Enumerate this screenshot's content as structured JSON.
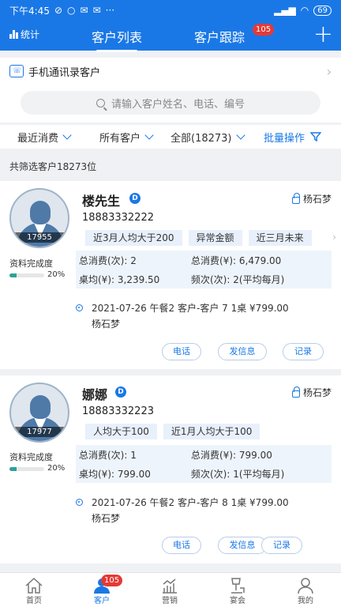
{
  "status_bar": {
    "time": "下午4:45",
    "dots": "···",
    "battery": "69"
  },
  "nav": {
    "stats_label": "统计",
    "tab_customer_list": "客户列表",
    "tab_customer_follow": "客户跟踪",
    "follow_badge": "105",
    "add": "+"
  },
  "contacts_label": "手机通讯录客户",
  "search": {
    "placeholder": "请输入客户姓名、电话、编号"
  },
  "filters": {
    "recent": "最近消费",
    "all_customers": "所有客户",
    "all_count": "全部(18273)",
    "batch": "批量操作"
  },
  "summary": "共筛选客户18273位",
  "labels": {
    "completeness": "资料完成度",
    "total_count": "总消费(次):",
    "total_amount": "总消费(¥):",
    "per_table": "桌均(¥):",
    "frequency": "频次(次):",
    "call": "电话",
    "message": "发信息",
    "record": "记录"
  },
  "customers": [
    {
      "id": "17955",
      "name": "楼先生",
      "level": "D",
      "owner": "杨石梦",
      "phone": "18883332222",
      "tags": [
        "近3月人均大于200",
        "异常金额",
        "近三月未来"
      ],
      "completeness": "20%",
      "completeness_value": 0.2,
      "total_count": "2",
      "total_amount": "6,479.00",
      "per_table": "3,239.50",
      "frequency": "2(平均每月)",
      "record_line": "2021-07-26   午餐2   客户-客户   7   1桌   ¥799.00",
      "record_staff": "杨石梦"
    },
    {
      "id": "17977",
      "name": "娜娜",
      "level": "D",
      "owner": "杨石梦",
      "phone": "18883332223",
      "tags": [
        "人均大于100",
        "近1月人均大于100"
      ],
      "completeness": "20%",
      "completeness_value": 0.2,
      "total_count": "1",
      "total_amount": "799.00",
      "per_table": "799.00",
      "frequency": "1(平均每月)",
      "record_line": "2021-07-26   午餐2   客户-客户   8   1桌   ¥799.00",
      "record_staff": "杨石梦"
    }
  ],
  "tabbar": {
    "home": "首页",
    "customers": "客户",
    "customers_badge": "105",
    "marketing": "营销",
    "banquet": "宴会",
    "mine": "我的"
  },
  "colors": {
    "primary": "#1a78e6",
    "badge": "#e53935",
    "progress": "#2ba39a"
  }
}
